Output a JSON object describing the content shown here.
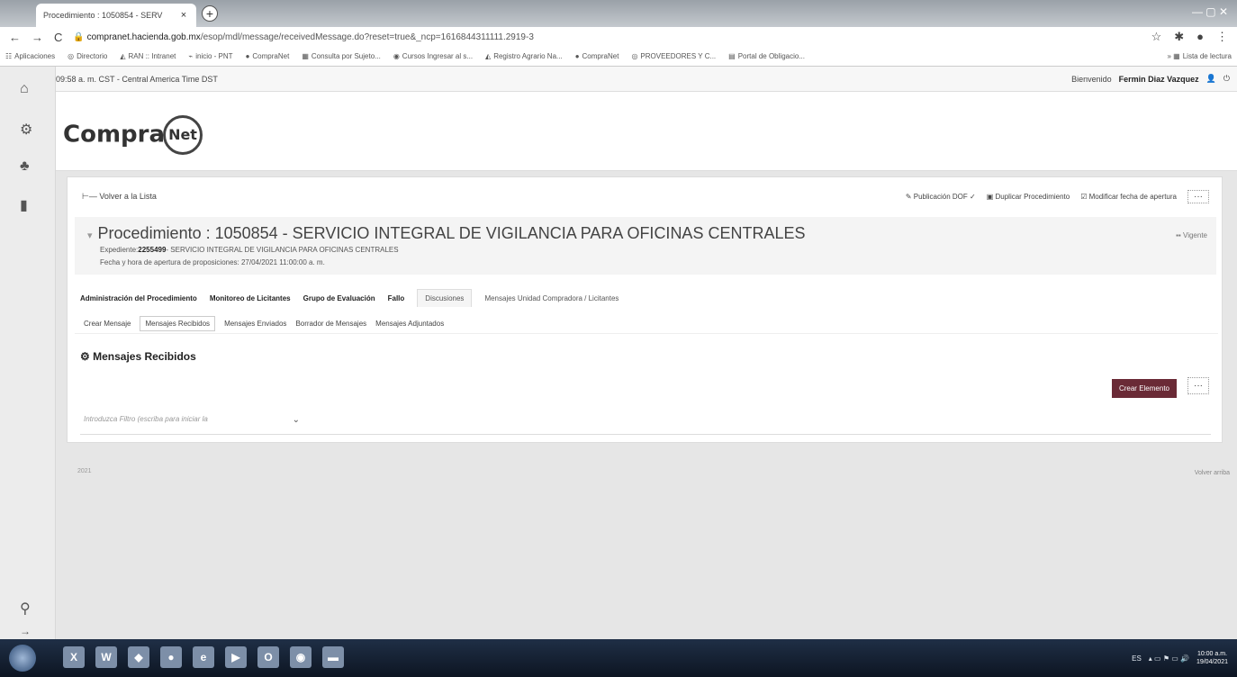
{
  "browser": {
    "tab_title": "Procedimiento : 1050854 - SERV",
    "tab_close": "×",
    "new_tab": "+",
    "url_host": "compranet.hacienda.gob.mx",
    "url_path": "/esop/mdl/message/receivedMessage.do?reset=true&_ncp=1616844311111.2919-3",
    "bookmarks": [
      {
        "label": "Aplicaciones",
        "icon": "grid-icon"
      },
      {
        "label": "Directorio",
        "icon": "globe-icon"
      },
      {
        "label": "RAN :: Intranet",
        "icon": "ran-icon"
      },
      {
        "label": "inicio - PNT",
        "icon": "pnt-icon"
      },
      {
        "label": "CompraNet",
        "icon": "dot-icon"
      },
      {
        "label": "Consulta por Sujeto...",
        "icon": "doc-icon"
      },
      {
        "label": "Cursos Ingresar al s...",
        "icon": "circle-icon"
      },
      {
        "label": "Registro Agrario Na...",
        "icon": "ran-icon"
      },
      {
        "label": "CompraNet",
        "icon": "dot-icon"
      },
      {
        "label": "PROVEEDORES Y C...",
        "icon": "globe-icon"
      },
      {
        "label": "Portal de Obligacio...",
        "icon": "doc-icon"
      }
    ],
    "reading_list": "Lista de lectura"
  },
  "header": {
    "time": "09:58 a. m. CST - Central America Time DST",
    "welcome_prefix": "Bienvenido",
    "user": "Fermin Diaz Vazquez"
  },
  "logo": {
    "text": "Compra",
    "net": "Net"
  },
  "card": {
    "back_label": "Volver a la Lista",
    "actions": [
      "Publicación DOF",
      "Duplicar Procedimiento",
      "Modificar fecha de apertura"
    ],
    "more": "···",
    "proc_title": "Procedimiento : 1050854 - SERVICIO INTEGRAL DE VIGILANCIA PARA OFICINAS CENTRALES",
    "exp_label": "Expediente:",
    "exp_number": "2255499",
    "exp_desc": "- SERVICIO INTEGRAL DE VIGILANCIA PARA OFICINAS CENTRALES",
    "fecha": "Fecha y hora de apertura de proposiciones: 27/04/2021 11:00:00 a. m.",
    "status": "Vigente",
    "main_tabs": [
      "Administración del Procedimiento",
      "Monitoreo de Licitantes",
      "Grupo de Evaluación",
      "Fallo",
      "Discusiones",
      "Mensajes Unidad Compradora / Licitantes"
    ],
    "sub_tabs": [
      "Crear Mensaje",
      "Mensajes Recibidos",
      "Mensajes Enviados",
      "Borrador de Mensajes",
      "Mensajes Adjuntados"
    ],
    "section_title": "Mensajes Recibidos",
    "create_button": "Crear Elemento",
    "filter_placeholder": "Introduzca Filtro (escriba para iniciar la"
  },
  "footer": {
    "left": "2021",
    "right": "Volver arriba"
  },
  "taskbar": {
    "lang": "ES",
    "time": "10:00 a.m.",
    "date": "19/04/2021"
  },
  "colors": {
    "primary_button": "#6a2a36",
    "taskbar": "#1a2638"
  }
}
